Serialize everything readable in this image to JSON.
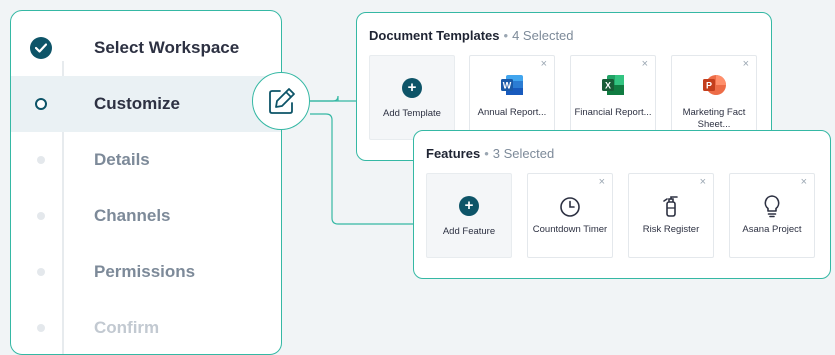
{
  "wizard": {
    "steps": [
      {
        "label": "Select Workspace",
        "state": "done"
      },
      {
        "label": "Customize",
        "state": "current"
      },
      {
        "label": "Details",
        "state": "todo"
      },
      {
        "label": "Channels",
        "state": "todo"
      },
      {
        "label": "Permissions",
        "state": "todo"
      },
      {
        "label": "Confirm",
        "state": "faint"
      }
    ]
  },
  "document_templates": {
    "title": "Document Templates",
    "separator": "•",
    "count": "4 Selected",
    "add_label": "Add Template",
    "items": [
      {
        "label": "Annual Report...",
        "icon": "word-icon"
      },
      {
        "label": "Financial Report...",
        "icon": "excel-icon"
      },
      {
        "label": "Marketing Fact Sheet...",
        "icon": "powerpoint-icon"
      }
    ]
  },
  "features": {
    "title": "Features",
    "separator": "•",
    "count": "3 Selected",
    "add_label": "Add Feature",
    "items": [
      {
        "label": "Countdown Timer",
        "icon": "clock-icon"
      },
      {
        "label": "Risk Register",
        "icon": "fire-extinguisher-icon"
      },
      {
        "label": "Asana Project",
        "icon": "lightbulb-icon"
      }
    ]
  },
  "icons": {
    "add": "+",
    "remove": "×"
  },
  "colors": {
    "accent": "#35b8a4",
    "primary": "#0d5468",
    "word": "#2b5797",
    "excel": "#1e7145",
    "powerpoint": "#d04423"
  }
}
